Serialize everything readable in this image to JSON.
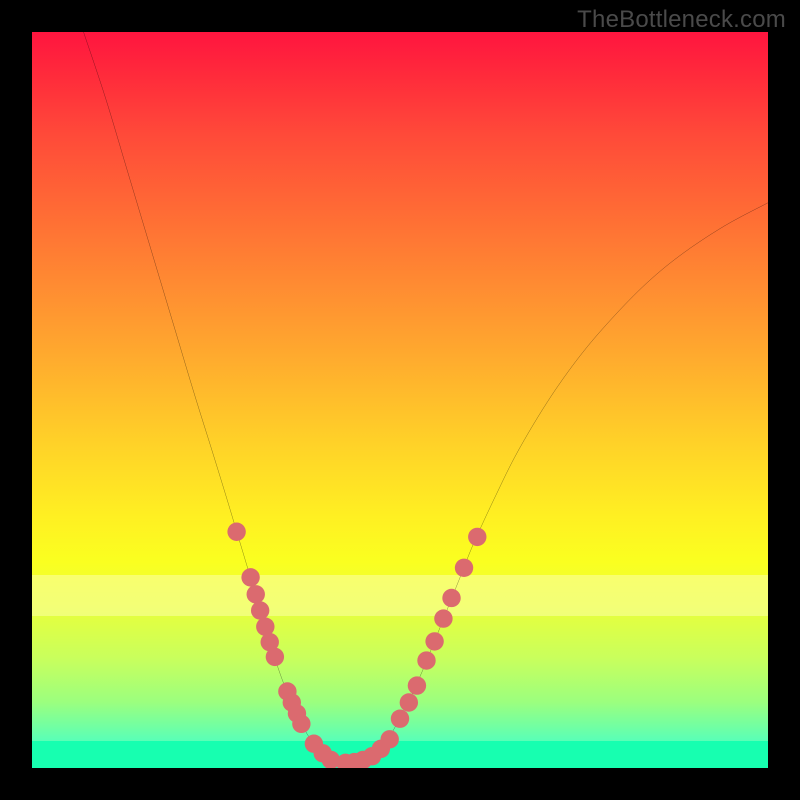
{
  "watermark": "TheBottleneck.com",
  "colors": {
    "frame_bg": "#000000",
    "curve_stroke": "#000000",
    "marker_fill": "#db6a6f",
    "gradient_top": "#ff153f",
    "gradient_bottom": "#26ffd8"
  },
  "chart_data": {
    "type": "line",
    "title": "",
    "xlabel": "",
    "ylabel": "",
    "xlim": [
      0,
      100
    ],
    "ylim": [
      0,
      100
    ],
    "grid": false,
    "legend": false,
    "curve": {
      "note": "Single V-shaped black curve on a vertical color gradient. x is percent of plot width (0=left), y is percent of plot height (0=top).",
      "points": [
        [
          7,
          0
        ],
        [
          10,
          9
        ],
        [
          13,
          19
        ],
        [
          16,
          29
        ],
        [
          19,
          39
        ],
        [
          22,
          49
        ],
        [
          24.5,
          57
        ],
        [
          26.5,
          63.5
        ],
        [
          28,
          68.5
        ],
        [
          29.5,
          73.5
        ],
        [
          31,
          78.5
        ],
        [
          32.5,
          83.5
        ],
        [
          34,
          88
        ],
        [
          35.5,
          91.5
        ],
        [
          37,
          94.7
        ],
        [
          38.5,
          97
        ],
        [
          40,
          98.3
        ],
        [
          41.5,
          99
        ],
        [
          42.5,
          99.3
        ],
        [
          44,
          99.3
        ],
        [
          45.5,
          98.8
        ],
        [
          47,
          97.6
        ],
        [
          48.5,
          95.8
        ],
        [
          50,
          93.2
        ],
        [
          52,
          89.2
        ],
        [
          54,
          84.5
        ],
        [
          56,
          79.5
        ],
        [
          58,
          74.5
        ],
        [
          60,
          69.5
        ],
        [
          63,
          63
        ],
        [
          66,
          57
        ],
        [
          70,
          50.3
        ],
        [
          74,
          44.6
        ],
        [
          78,
          39.8
        ],
        [
          83,
          34.6
        ],
        [
          88,
          30.4
        ],
        [
          94,
          26.4
        ],
        [
          100,
          23.2
        ]
      ]
    },
    "markers": {
      "note": "Pink circular markers overlaid along the lower portion of the V curve; same coordinate convention as curve.points.",
      "radius_pct": 1.25,
      "points": [
        [
          27.8,
          67.9
        ],
        [
          29.7,
          74.1
        ],
        [
          30.4,
          76.4
        ],
        [
          31.0,
          78.6
        ],
        [
          31.7,
          80.8
        ],
        [
          32.3,
          82.9
        ],
        [
          33.0,
          84.9
        ],
        [
          34.7,
          89.6
        ],
        [
          35.3,
          91.1
        ],
        [
          36.0,
          92.6
        ],
        [
          36.6,
          94.0
        ],
        [
          38.3,
          96.7
        ],
        [
          39.5,
          98.0
        ],
        [
          40.6,
          98.9
        ],
        [
          42.6,
          99.3
        ],
        [
          43.8,
          99.2
        ],
        [
          45.0,
          98.9
        ],
        [
          46.2,
          98.4
        ],
        [
          47.4,
          97.4
        ],
        [
          48.6,
          96.1
        ],
        [
          50.0,
          93.3
        ],
        [
          51.2,
          91.1
        ],
        [
          52.3,
          88.8
        ],
        [
          53.6,
          85.4
        ],
        [
          54.7,
          82.8
        ],
        [
          55.9,
          79.7
        ],
        [
          57.0,
          76.9
        ],
        [
          58.7,
          72.8
        ],
        [
          60.5,
          68.6
        ]
      ]
    }
  }
}
